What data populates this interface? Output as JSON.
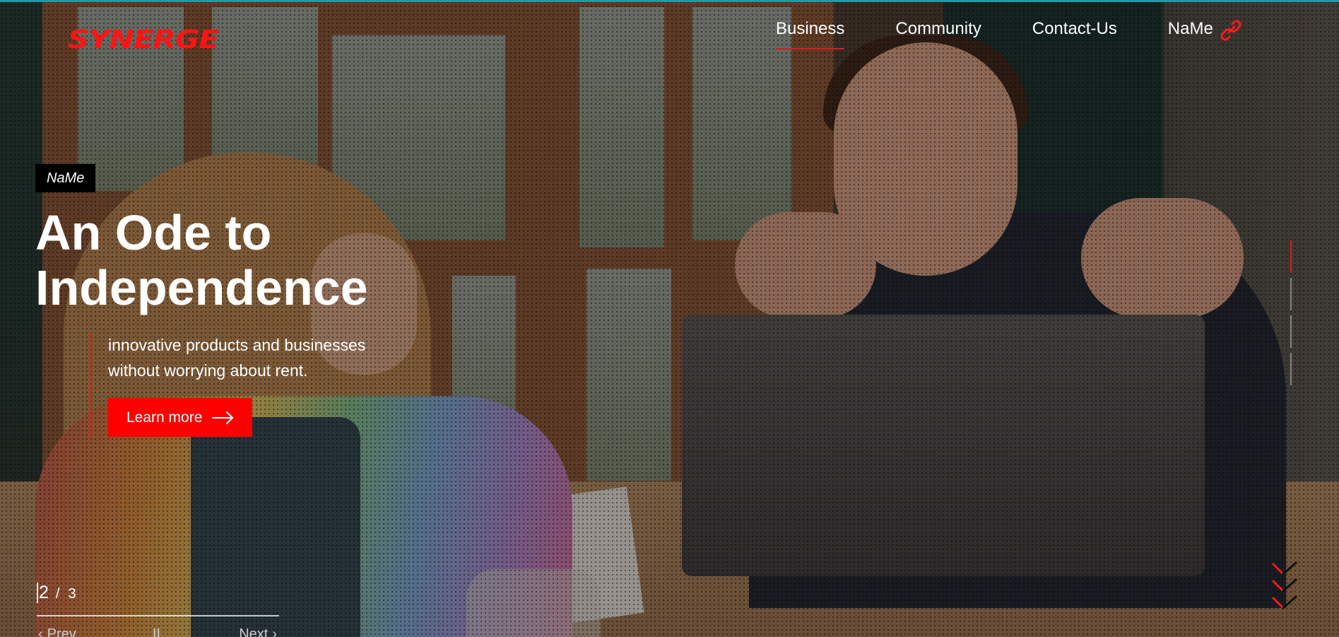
{
  "brand": {
    "logo_text": "SYNERGE",
    "accent_color": "#ff0000"
  },
  "nav": {
    "items": [
      {
        "label": "Business",
        "active": true
      },
      {
        "label": "Community",
        "active": false
      },
      {
        "label": "Contact-Us",
        "active": false
      },
      {
        "label": "NaMe",
        "active": false,
        "icon": "link-icon"
      }
    ]
  },
  "hero": {
    "tag": "NaMe",
    "headline_line1": "An Ode to",
    "headline_line2": "Independence",
    "subtitle_line1": "innovative products and businesses",
    "subtitle_line2": "without worrying about rent.",
    "cta_label": "Learn more"
  },
  "slider": {
    "current": "2",
    "separator": "/",
    "total": "3",
    "prev_label": "Prev",
    "pause_label": "II",
    "next_label": "Next",
    "indicator_count": 4,
    "active_indicator": 0
  }
}
